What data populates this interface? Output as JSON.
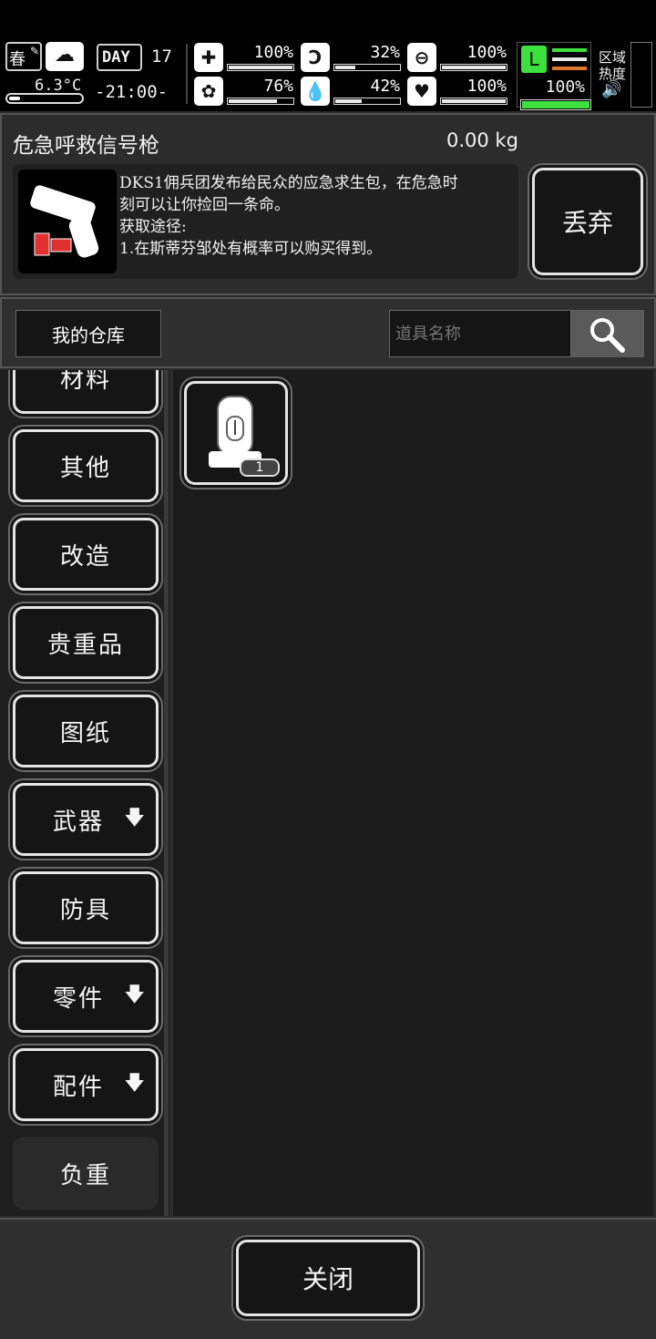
{
  "status": {
    "season": "春",
    "temperature": "6.3°C",
    "day_label": "DAY",
    "day_number": "17",
    "time": "-21:00-",
    "health_pct": "100%",
    "hunger_pct": "32%",
    "fatigue_pct": "100%",
    "sanity_pct": "76%",
    "thirst_pct": "42%",
    "mood_pct": "100%",
    "stamina_pct": "100%",
    "levels": {
      "health": 1.0,
      "hunger": 0.32,
      "fatigue": 1.0,
      "sanity": 0.76,
      "thirst": 0.42,
      "mood": 1.0,
      "stamina": 1.0
    },
    "zone_heat_label_1": "区域",
    "zone_heat_label_2": "热度",
    "icons": [
      "leaf-icon",
      "cloud-rain-icon",
      "thermometer-icon",
      "medkit-icon",
      "stomach-icon",
      "pill-icon",
      "brain-icon",
      "water-drop-icon",
      "heart-icon",
      "boot-icon",
      "speaker-icon"
    ]
  },
  "item_detail": {
    "name": "危急呼救信号枪",
    "weight": "0.00 kg",
    "description_line1": "DKS1佣兵团发布给民众的应急求生包，在危急时",
    "description_line2": "刻可以让你捡回一条命。",
    "description_line3": "获取途径:",
    "description_line4": "1.在斯蒂芬邹处有概率可以购买得到。",
    "discard_label": "丢弃"
  },
  "storage": {
    "title": "我的仓库",
    "search_placeholder": "道具名称"
  },
  "categories": [
    {
      "label": "材料"
    },
    {
      "label": "其他"
    },
    {
      "label": "改造"
    },
    {
      "label": "贵重品"
    },
    {
      "label": "图纸"
    },
    {
      "label": "武器",
      "arrow": "🡇"
    },
    {
      "label": "防具"
    },
    {
      "label": "零件",
      "arrow": "🡇"
    },
    {
      "label": "配件",
      "arrow": "🡇"
    },
    {
      "label": "负重"
    }
  ],
  "grid_items": [
    {
      "icon": "backpack-icon",
      "count": "1"
    }
  ],
  "footer": {
    "close_label": "关闭"
  },
  "colors": {
    "accent_green": "#3ee03e",
    "accent_orange": "#e07a2a",
    "panel": "#2b2b2b",
    "button_bg": "#151515"
  }
}
